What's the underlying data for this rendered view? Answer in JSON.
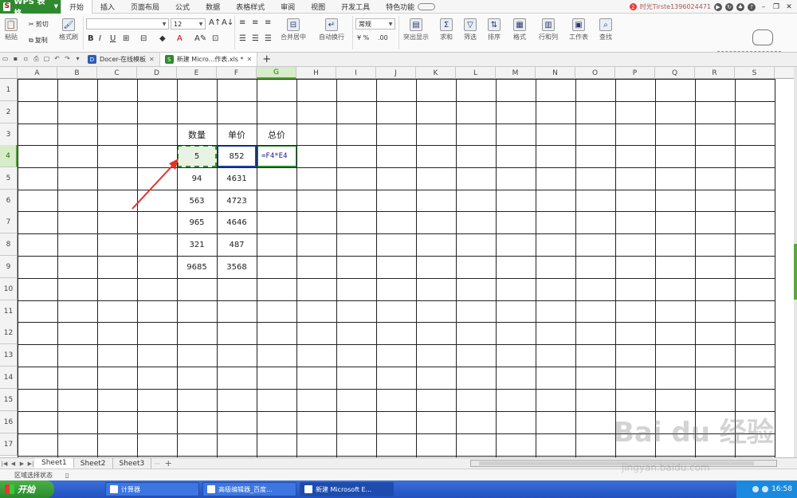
{
  "app": {
    "logo_text": "WPS 表格"
  },
  "menu": [
    "开始",
    "插入",
    "页面布局",
    "公式",
    "数据",
    "表格样式",
    "审阅",
    "视图",
    "开发工具",
    "特色功能"
  ],
  "user": {
    "notice_count": "2",
    "name": "时光Tirste1396024471"
  },
  "ribbon": {
    "paste": "粘贴",
    "cut": "剪切",
    "copy": "复制",
    "format_painter": "格式刷",
    "font_name": "",
    "font_size": "12",
    "merge_center": "合并居中",
    "auto_wrap": "自动换行",
    "number_format": "常规",
    "highlight": "突出显示",
    "sum": "求和",
    "filter": "筛选",
    "sort": "排序",
    "format": "格式",
    "row_col": "行和列",
    "worksheet": "工作表",
    "find": "查找"
  },
  "doc_tabs": [
    {
      "label": "Docer-在线模板"
    },
    {
      "label": "新建 Micro...作表.xls *"
    }
  ],
  "columns": [
    "A",
    "B",
    "C",
    "D",
    "E",
    "F",
    "G",
    "H",
    "I",
    "J",
    "K",
    "L",
    "M",
    "N",
    "O",
    "P",
    "Q",
    "R",
    "S"
  ],
  "rows": [
    "1",
    "2",
    "3",
    "4",
    "5",
    "6",
    "7",
    "8",
    "9",
    "10",
    "11",
    "12",
    "13",
    "14",
    "15",
    "16",
    "17"
  ],
  "table": {
    "headers": {
      "quantity": "数量",
      "unit_price": "单价",
      "total": "总价"
    },
    "quantity": [
      "5",
      "94",
      "563",
      "965",
      "321",
      "9685"
    ],
    "unit_price": [
      "852",
      "4631",
      "4723",
      "4646",
      "487",
      "3568"
    ],
    "editing_formula": "=F4*E4"
  },
  "sheets": [
    "Sheet1",
    "Sheet2",
    "Sheet3"
  ],
  "status": {
    "mode": "区域选择状态"
  },
  "taskbar": {
    "start": "开始",
    "tasks": [
      "计算器",
      "高级编辑器_百度...",
      "新建 Microsoft E..."
    ],
    "time": "16:58"
  },
  "watermark": {
    "main": "Bai du 经验",
    "sub": "jingyan.baidu.com"
  },
  "colors": {
    "accent_green": "#5aa83c",
    "wps_green": "#2f8a2f",
    "taskbar_blue": "#2350c0"
  }
}
